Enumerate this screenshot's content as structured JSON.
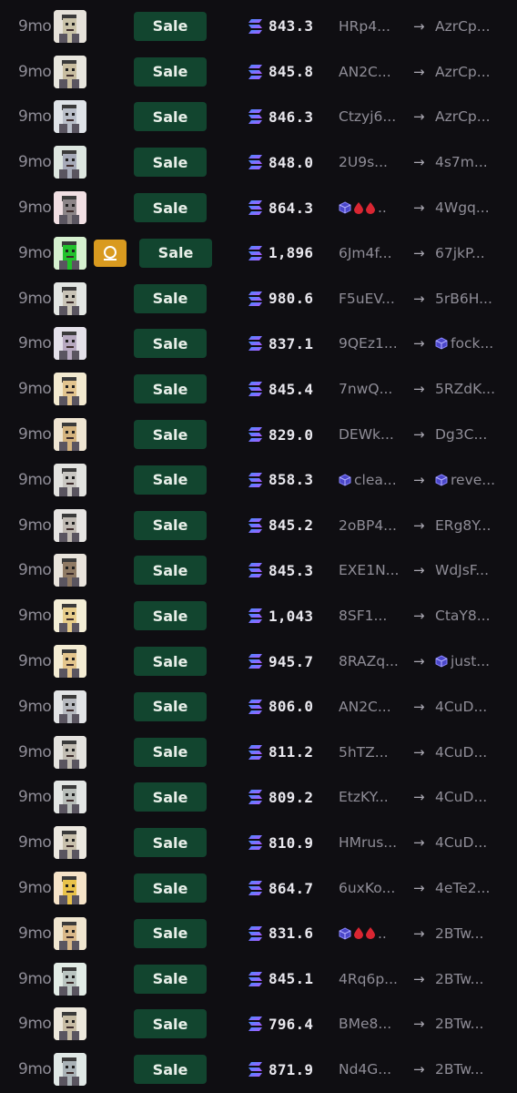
{
  "colors": {
    "background": "#0f0e12",
    "sale_bg": "#12452f",
    "sale_text": "#e8efe9",
    "badge_bg": "#d99a1f",
    "sol_gradient": [
      "#9945ff",
      "#14f195"
    ]
  },
  "rows": [
    {
      "age": "9mo",
      "label": "Sale",
      "price": "843.3",
      "from": "HRp4...",
      "to": "AzrCp...",
      "avatar_bg": "#e6e2da",
      "skin": "#c9c2a8"
    },
    {
      "age": "9mo",
      "label": "Sale",
      "price": "845.8",
      "from": "AN2C...",
      "to": "AzrCp...",
      "avatar_bg": "#e8e6de",
      "skin": "#c8bda0"
    },
    {
      "age": "9mo",
      "label": "Sale",
      "price": "846.3",
      "from": "Ctzyj6...",
      "to": "AzrCp...",
      "avatar_bg": "#dfe3e8",
      "skin": "#b9bec8"
    },
    {
      "age": "9mo",
      "label": "Sale",
      "price": "848.0",
      "from": "2U9s...",
      "to": "4s7m...",
      "avatar_bg": "#dde6e0",
      "skin": "#a6aab8"
    },
    {
      "age": "9mo",
      "label": "Sale",
      "price": "864.3",
      "from": "..",
      "from_icons": true,
      "to": "4Wgq...",
      "avatar_bg": "#f1dfe3",
      "skin": "#8c8588"
    },
    {
      "age": "9mo",
      "label": "Sale",
      "price": "1,896",
      "from": "6Jm4f...",
      "to": "67jkP...",
      "avatar_bg": "#d5f0cf",
      "skin": "#22c22c",
      "badge": true,
      "badge_icon": "circle-bag-icon"
    },
    {
      "age": "9mo",
      "label": "Sale",
      "price": "980.6",
      "from": "F5uEV...",
      "to": "5rB6H...",
      "avatar_bg": "#e3e6e3",
      "skin": "#c8c3b6"
    },
    {
      "age": "9mo",
      "label": "Sale",
      "price": "837.1",
      "from": "9QEz1...",
      "to": "fock...",
      "to_cube": true,
      "avatar_bg": "#e4e1ea",
      "skin": "#b7a9c0"
    },
    {
      "age": "9mo",
      "label": "Sale",
      "price": "845.4",
      "from": "7nwQ...",
      "to": "5RZdK...",
      "avatar_bg": "#f3ead0",
      "skin": "#e2c48e"
    },
    {
      "age": "9mo",
      "label": "Sale",
      "price": "829.0",
      "from": "DEWk...",
      "to": "Dg3C...",
      "avatar_bg": "#efe5d2",
      "skin": "#d4b37e"
    },
    {
      "age": "9mo",
      "label": "Sale",
      "price": "858.3",
      "from": "clea...",
      "from_cube": true,
      "to": "reve...",
      "to_cube": true,
      "avatar_bg": "#e3e3e0",
      "skin": "#c9c7c2"
    },
    {
      "age": "9mo",
      "label": "Sale",
      "price": "845.2",
      "from": "2oBP4...",
      "to": "ERg8Y...",
      "avatar_bg": "#e6e4e2",
      "skin": "#bfb9b2"
    },
    {
      "age": "9mo",
      "label": "Sale",
      "price": "845.3",
      "from": "EXE1N...",
      "to": "WdJsF...",
      "avatar_bg": "#e9e4dc",
      "skin": "#8f7a64"
    },
    {
      "age": "9mo",
      "label": "Sale",
      "price": "1,043",
      "from": "8SF1...",
      "to": "CtaY8...",
      "avatar_bg": "#f4eed6",
      "skin": "#e6cc8a"
    },
    {
      "age": "9mo",
      "label": "Sale",
      "price": "945.7",
      "from": "8RAZq...",
      "to": "just...",
      "to_cube": true,
      "avatar_bg": "#f4ecd3",
      "skin": "#e4c58c"
    },
    {
      "age": "9mo",
      "label": "Sale",
      "price": "806.0",
      "from": "AN2C...",
      "to": "4CuD...",
      "avatar_bg": "#e2e4e6",
      "skin": "#b6b9bf"
    },
    {
      "age": "9mo",
      "label": "Sale",
      "price": "811.2",
      "from": "5hTZ...",
      "to": "4CuD...",
      "avatar_bg": "#e5e3df",
      "skin": "#c2bdb3"
    },
    {
      "age": "9mo",
      "label": "Sale",
      "price": "809.2",
      "from": "EtzKY...",
      "to": "4CuD...",
      "avatar_bg": "#e3e6e4",
      "skin": "#b8bdb9"
    },
    {
      "age": "9mo",
      "label": "Sale",
      "price": "810.9",
      "from": "HMrus...",
      "to": "4CuD...",
      "avatar_bg": "#ece8e0",
      "skin": "#c8c0ac"
    },
    {
      "age": "9mo",
      "label": "Sale",
      "price": "864.7",
      "from": "6uxKo...",
      "to": "4eTe2...",
      "avatar_bg": "#f6e3c8",
      "skin": "#e8c24a"
    },
    {
      "age": "9mo",
      "label": "Sale",
      "price": "831.6",
      "from": "..",
      "from_icons": true,
      "to": "2BTw...",
      "avatar_bg": "#f0e6d0",
      "skin": "#d9b889"
    },
    {
      "age": "9mo",
      "label": "Sale",
      "price": "845.1",
      "from": "4Rq6p...",
      "to": "2BTw...",
      "avatar_bg": "#e2ece6",
      "skin": "#b9c4c0"
    },
    {
      "age": "9mo",
      "label": "Sale",
      "price": "796.4",
      "from": "BMe8...",
      "to": "2BTw...",
      "avatar_bg": "#ede8dc",
      "skin": "#c7bca4"
    },
    {
      "age": "9mo",
      "label": "Sale",
      "price": "871.9",
      "from": "Nd4G...",
      "to": "2BTw...",
      "avatar_bg": "#e0e8e6",
      "skin": "#a9b2b6"
    }
  ]
}
